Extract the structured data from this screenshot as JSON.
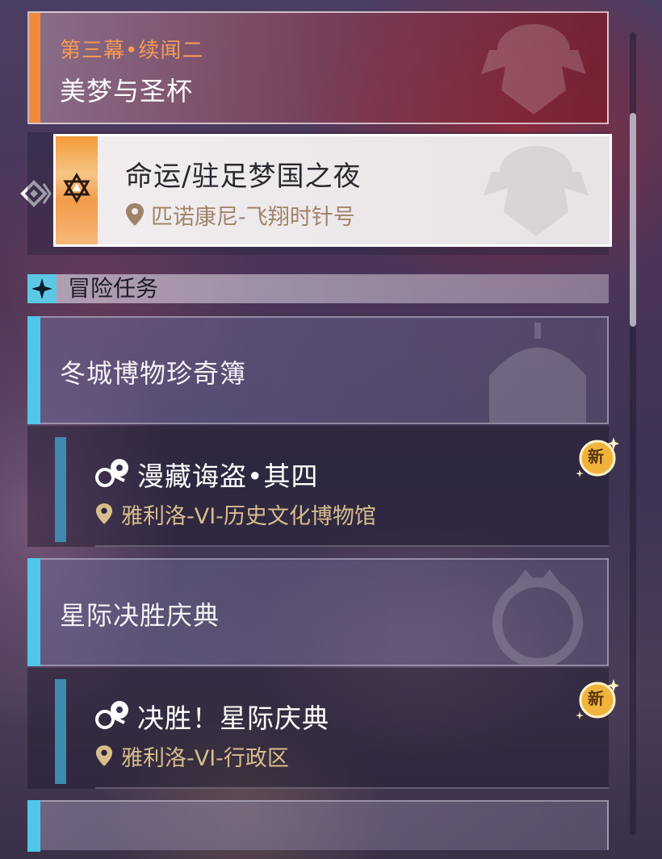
{
  "main_quest": {
    "chapter": "第三幕•续闻二",
    "title": "美梦与圣杯"
  },
  "current_quest": {
    "title": "命运/驻足梦国之夜",
    "location": "匹诺康尼-飞翔时针号"
  },
  "section": {
    "label": "冒险任务"
  },
  "groups": [
    {
      "title": "冬城博物珍奇簿",
      "quest": {
        "title": "漫藏诲盗•其四",
        "location": "雅利洛-VI-历史文化博物馆",
        "badge": "新"
      }
    },
    {
      "title": "星际决胜庆典",
      "quest": {
        "title": "决胜！星际庆典",
        "location": "雅利洛-VI-行政区",
        "badge": "新"
      }
    }
  ],
  "colors": {
    "main_accent": "#f28a3c",
    "adventure_accent": "#4fc6ea",
    "quest_bar": "#3f8bb0",
    "location_gold": "#d8bd8c",
    "badge_gold": "#f0b43c"
  }
}
